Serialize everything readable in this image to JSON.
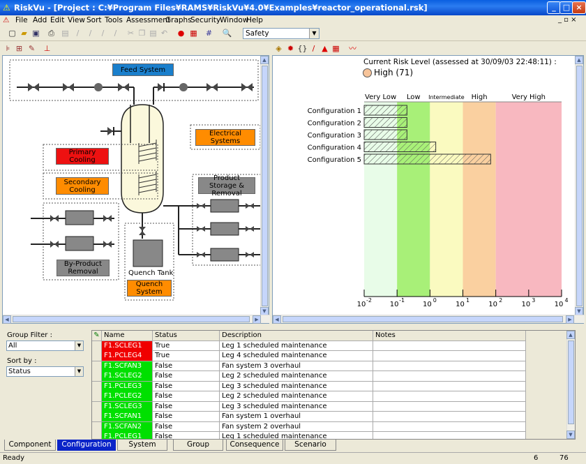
{
  "app": {
    "title": "RiskVu - [Project : C:¥Program Files¥RAMS¥RiskVu¥4.0¥Examples¥reactor_operational.rsk]"
  },
  "menu": [
    "File",
    "Add",
    "Edit",
    "View",
    "Sort",
    "Tools",
    "Assessment",
    "Graphs",
    "Security",
    "Window",
    "Help"
  ],
  "toolbar": {
    "mode_value": "Safety"
  },
  "diagram": {
    "feed_system": "Feed System",
    "electrical_systems": "Electrical Systems",
    "primary_cooling": "Primary Cooling",
    "secondary_cooling": "Secondary Cooling",
    "product_storage": "Product Storage & Removal",
    "byproduct_removal": "By-Product Removal",
    "quench_tank_label": "Quench Tank",
    "quench_system": "Quench System"
  },
  "risk": {
    "heading": "Current Risk Level (assessed at 30/09/03 22:48:11) :",
    "level_text": "High (71)",
    "bands": [
      "Very Low",
      "Low",
      "Intermediate",
      "High",
      "Very High"
    ],
    "band_colors": [
      "#e8fce8",
      "#a8f078",
      "#fafac0",
      "#fad0a0",
      "#f8b8c0"
    ],
    "x_ticks": [
      "10",
      "10",
      "10",
      "10",
      "10",
      "10",
      "10"
    ],
    "x_exps": [
      "-2",
      "-1",
      "0",
      "1",
      "2",
      "3",
      "4"
    ]
  },
  "chart_data": {
    "type": "bar",
    "orientation": "horizontal",
    "x_scale": "log",
    "xlim": [
      0.01,
      10000
    ],
    "categories": [
      "Configuration 1",
      "Configuration 2",
      "Configuration 3",
      "Configuration 4",
      "Configuration 5"
    ],
    "values": [
      0.2,
      0.2,
      0.2,
      1.5,
      70
    ]
  },
  "filters": {
    "group_filter_label": "Group Filter :",
    "group_filter_value": "All",
    "sort_label": "Sort by :",
    "sort_value": "Status"
  },
  "table": {
    "headers": [
      "Name",
      "Status",
      "Description",
      "Notes"
    ],
    "rows": [
      {
        "name": "F1.SCLEG1",
        "status": "True",
        "desc": "Leg 1 scheduled maintenance",
        "color": "#f00000"
      },
      {
        "name": "F1.PCLEG4",
        "status": "True",
        "desc": "Leg 4 scheduled maintenance",
        "color": "#f00000"
      },
      {
        "name": "F1.SCFAN3",
        "status": "False",
        "desc": "Fan system 3 overhaul",
        "color": "#00e000"
      },
      {
        "name": "F1.SCLEG2",
        "status": "False",
        "desc": "Leg 2 scheduled maintenance",
        "color": "#00e000"
      },
      {
        "name": "F1.PCLEG3",
        "status": "False",
        "desc": "Leg 3 scheduled maintenance",
        "color": "#00e000"
      },
      {
        "name": "F1.PCLEG2",
        "status": "False",
        "desc": "Leg 2 scheduled maintenance",
        "color": "#00e000"
      },
      {
        "name": "F1.SCLEG3",
        "status": "False",
        "desc": "Leg 3 scheduled maintenance",
        "color": "#00e000"
      },
      {
        "name": "F1.SCFAN1",
        "status": "False",
        "desc": "Fan system 1 overhaul",
        "color": "#00e000"
      },
      {
        "name": "F1.SCFAN2",
        "status": "False",
        "desc": "Fan system 2 overhaul",
        "color": "#00e000"
      },
      {
        "name": "F1.PCLEG1",
        "status": "False",
        "desc": "Leg 1 scheduled maintenance",
        "color": "#00e000"
      }
    ]
  },
  "tabs": [
    "Component",
    "Configuration",
    "System",
    "Group",
    "Consequence",
    "Scenario"
  ],
  "status": {
    "text": "Ready",
    "num1": "6",
    "num2": "76"
  }
}
